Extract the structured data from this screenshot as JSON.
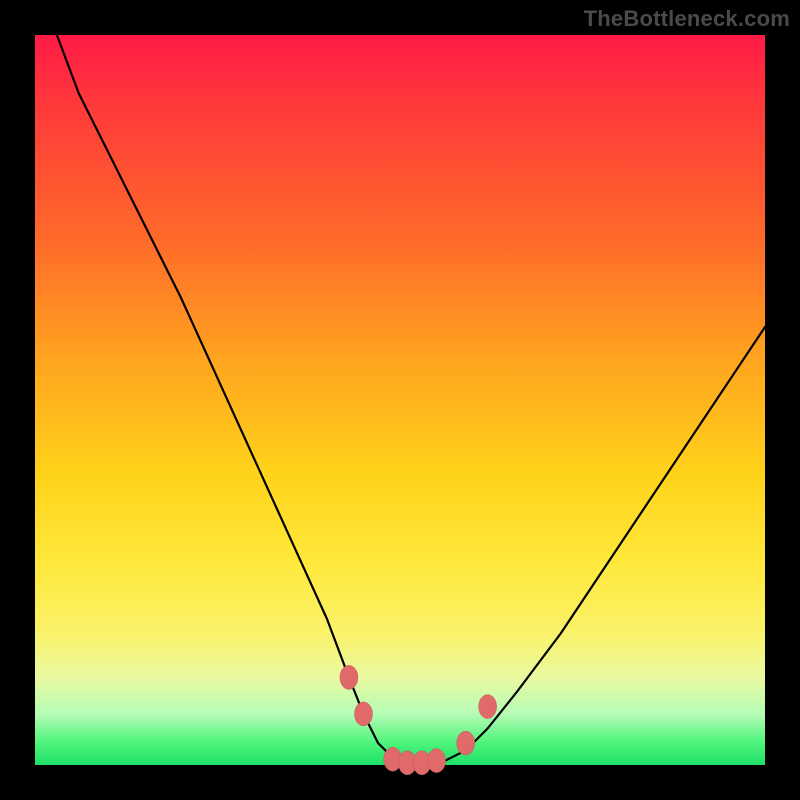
{
  "watermark": "TheBottleneck.com",
  "colors": {
    "gradient_top": "#ff1a46",
    "gradient_bottom": "#1fe06a",
    "curve": "#000000",
    "dots": "#e06a6a",
    "frame": "#000000"
  },
  "chart_data": {
    "type": "line",
    "title": "",
    "xlabel": "",
    "ylabel": "",
    "xlim": [
      0,
      100
    ],
    "ylim": [
      0,
      100
    ],
    "grid": false,
    "legend": false,
    "annotations": [
      "TheBottleneck.com"
    ],
    "series": [
      {
        "name": "bottleneck-curve",
        "x": [
          3,
          6,
          10,
          15,
          20,
          25,
          30,
          35,
          40,
          43,
          45,
          47,
          49,
          51,
          53,
          55,
          57,
          59,
          62,
          66,
          72,
          80,
          88,
          96,
          100
        ],
        "values": [
          100,
          92,
          84,
          74,
          64,
          53,
          42,
          31,
          20,
          12,
          7,
          3,
          1,
          0,
          0,
          0,
          1,
          2,
          5,
          10,
          18,
          30,
          42,
          54,
          60
        ]
      }
    ],
    "markers": [
      {
        "name": "left-upper-dot",
        "x": 43,
        "y": 12
      },
      {
        "name": "left-lower-dot",
        "x": 45,
        "y": 7
      },
      {
        "name": "flat-dot-1",
        "x": 49,
        "y": 0.8
      },
      {
        "name": "flat-dot-2",
        "x": 51,
        "y": 0.3
      },
      {
        "name": "flat-dot-3",
        "x": 53,
        "y": 0.3
      },
      {
        "name": "flat-dot-4",
        "x": 55,
        "y": 0.6
      },
      {
        "name": "right-lower-dot",
        "x": 59,
        "y": 3
      },
      {
        "name": "right-upper-dot",
        "x": 62,
        "y": 8
      }
    ]
  }
}
